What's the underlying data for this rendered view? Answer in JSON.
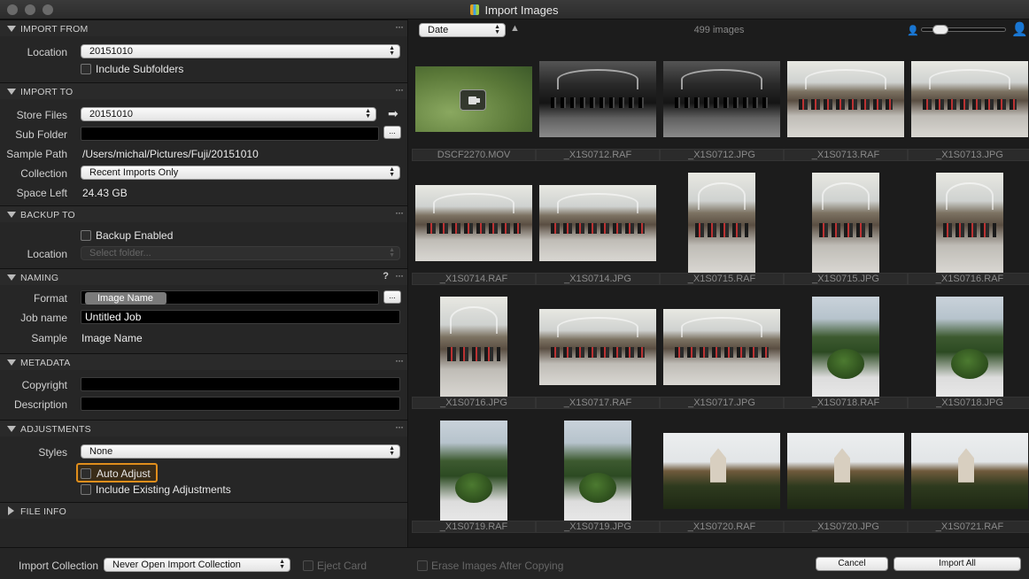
{
  "window": {
    "title": "Import Images"
  },
  "import_from": {
    "header": "IMPORT FROM",
    "location_label": "Location",
    "location_value": "20151010",
    "include_subfolders": "Include Subfolders"
  },
  "import_to": {
    "header": "IMPORT TO",
    "store_files_label": "Store Files",
    "store_files_value": "20151010",
    "sub_folder_label": "Sub Folder",
    "sub_folder_value": "",
    "sample_path_label": "Sample Path",
    "sample_path_value": "/Users/michal/Pictures/Fuji/20151010",
    "collection_label": "Collection",
    "collection_value": "Recent Imports Only",
    "space_left_label": "Space Left",
    "space_left_value": "24.43 GB"
  },
  "backup_to": {
    "header": "BACKUP TO",
    "backup_enabled": "Backup Enabled",
    "location_label": "Location",
    "location_placeholder": "Select folder..."
  },
  "naming": {
    "header": "NAMING",
    "help": "?",
    "format_label": "Format",
    "format_token": "Image Name",
    "job_name_label": "Job name",
    "job_name_value": "Untitled Job",
    "sample_label": "Sample",
    "sample_value": "Image Name"
  },
  "metadata": {
    "header": "METADATA",
    "copyright_label": "Copyright",
    "copyright_value": "",
    "description_label": "Description",
    "description_value": ""
  },
  "adjustments": {
    "header": "ADJUSTMENTS",
    "styles_label": "Styles",
    "styles_value": "None",
    "auto_adjust": "Auto Adjust",
    "include_existing": "Include Existing Adjustments"
  },
  "file_info": {
    "header": "FILE INFO"
  },
  "browser": {
    "sort_value": "Date",
    "count": "499 images",
    "zoom_level": 0.15
  },
  "thumbnails": [
    {
      "name": "DSCF2270.MOV",
      "kind": "grass"
    },
    {
      "name": "_X1S0712.RAF",
      "kind": "mall-d"
    },
    {
      "name": "_X1S0712.JPG",
      "kind": "mall-d"
    },
    {
      "name": "_X1S0713.RAF",
      "kind": "mall-l"
    },
    {
      "name": "_X1S0713.JPG",
      "kind": "mall-l"
    },
    {
      "name": "_X1S0714.RAF",
      "kind": "mall-l"
    },
    {
      "name": "_X1S0714.JPG",
      "kind": "mall-l"
    },
    {
      "name": "_X1S0715.RAF",
      "kind": "mall-l"
    },
    {
      "name": "_X1S0715.JPG",
      "kind": "mall-l"
    },
    {
      "name": "_X1S0716.RAF",
      "kind": "mall-l"
    },
    {
      "name": "_X1S0716.JPG",
      "kind": "mall-l"
    },
    {
      "name": "_X1S0717.RAF",
      "kind": "mall-l"
    },
    {
      "name": "_X1S0717.JPG",
      "kind": "mall-l"
    },
    {
      "name": "_X1S0718.RAF",
      "kind": "garden"
    },
    {
      "name": "_X1S0718.JPG",
      "kind": "garden"
    },
    {
      "name": "_X1S0719.RAF",
      "kind": "garden"
    },
    {
      "name": "_X1S0719.JPG",
      "kind": "garden"
    },
    {
      "name": "_X1S0720.RAF",
      "kind": "church"
    },
    {
      "name": "_X1S0720.JPG",
      "kind": "church"
    },
    {
      "name": "_X1S0721.RAF",
      "kind": "church"
    }
  ],
  "footer": {
    "import_collection_label": "Import Collection",
    "import_collection_value": "Never Open Import Collection",
    "eject_card": "Eject Card",
    "erase_images": "Erase Images After Copying",
    "cancel": "Cancel",
    "import_all": "Import All"
  }
}
